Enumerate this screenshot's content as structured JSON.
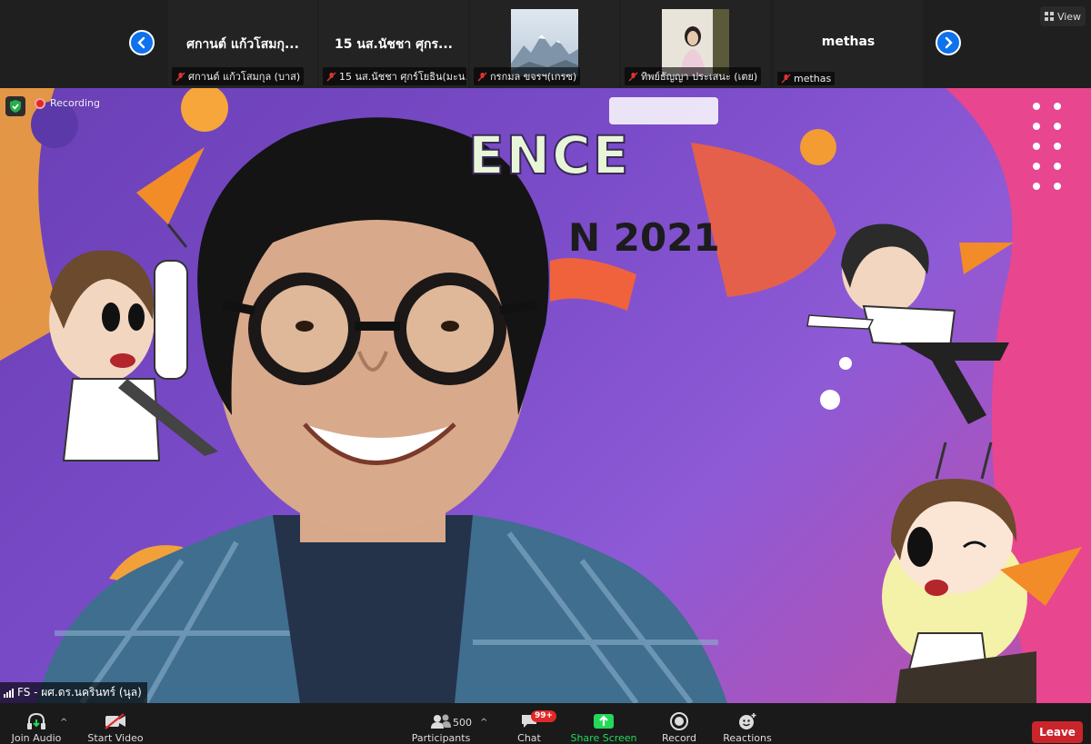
{
  "participants": [
    {
      "name": "ศกานต์ แก้วโสมกุ...",
      "label": "ศกานต์ แก้วโสมกุล (บาส)"
    },
    {
      "name": "15 นส.นัชชา ศุกร...",
      "label": "15 นส.นัชชา ศุกร์โยธิน(มะน..."
    },
    {
      "name": "",
      "label": "กรกมล ขจรฯ(เกรซ)"
    },
    {
      "name": "",
      "label": "ทิพย์ธัญญา ประเสนะ (เตย)"
    },
    {
      "name": "methas",
      "label": "methas"
    }
  ],
  "view_label": "View",
  "recording_label": "Recording",
  "speaker_label": "FS - ผศ.ดร.นครินทร์ (นุล)",
  "banner": {
    "line1": "ENCE",
    "line2": "N 2021"
  },
  "toolbar": {
    "join_audio": "Join Audio",
    "start_video": "Start Video",
    "participants": "Participants",
    "participants_count": "500",
    "chat": "Chat",
    "chat_badge": "99+",
    "share_screen": "Share Screen",
    "record": "Record",
    "reactions": "Reactions",
    "leave": "Leave"
  },
  "colors": {
    "accent": "#0e72ed",
    "leave": "#c9252b",
    "share": "#23d959",
    "recording": "#e02828"
  }
}
